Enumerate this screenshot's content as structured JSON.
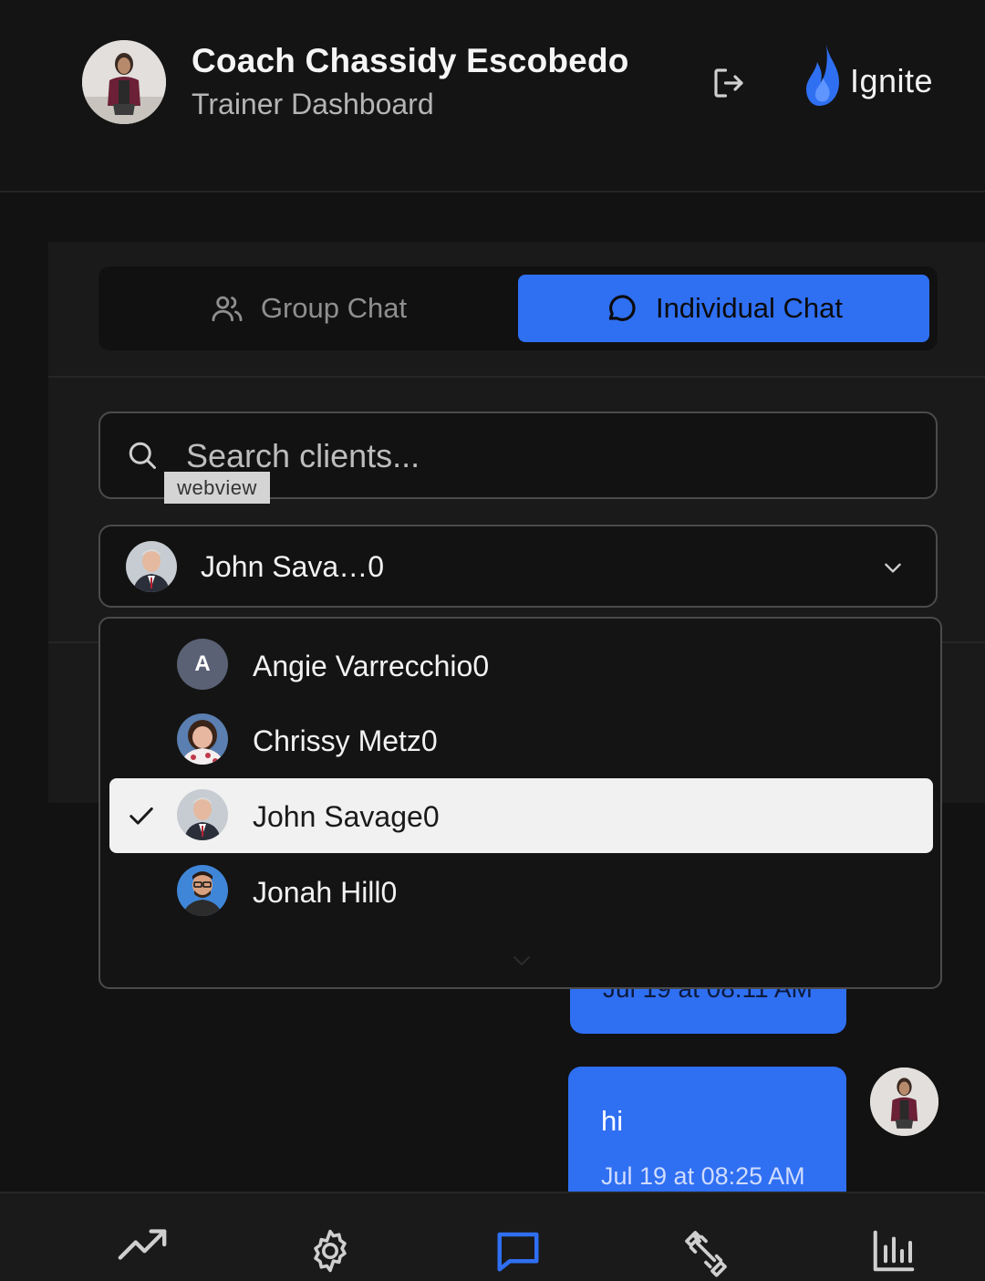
{
  "header": {
    "coach_name": "Coach Chassidy Escobedo",
    "subtitle": "Trainer Dashboard",
    "logo_text": "Ignite",
    "logout_icon": "logout-icon"
  },
  "tabs": [
    {
      "label": "Group Chat",
      "icon": "users-icon",
      "active": false
    },
    {
      "label": "Individual Chat",
      "icon": "chat-bubble-icon",
      "active": true
    }
  ],
  "search": {
    "placeholder": "Search clients...",
    "overlay_tag": "webview"
  },
  "client_select": {
    "selected_value": "John Sava…0"
  },
  "client_options": [
    {
      "label": "Angie Varrecchio0",
      "avatar_letter": "A",
      "selected": false
    },
    {
      "label": "Chrissy Metz0",
      "selected": false
    },
    {
      "label": "John Savage0",
      "selected": true
    },
    {
      "label": "Jonah Hill0",
      "selected": false
    }
  ],
  "messages": [
    {
      "text": "",
      "time": "Jul 19 at 08:11 AM"
    },
    {
      "text": "hi",
      "time": "Jul 19 at 08:25 AM"
    }
  ],
  "bottom_nav": [
    {
      "icon": "trending-up-icon",
      "active": false
    },
    {
      "icon": "gear-icon",
      "active": false
    },
    {
      "icon": "chat-icon",
      "active": true
    },
    {
      "icon": "dumbbell-icon",
      "active": false
    },
    {
      "icon": "bar-chart-icon",
      "active": false
    }
  ],
  "colors": {
    "accent": "#2f6ff2",
    "background": "#121212",
    "panel": "#1a1a1a"
  }
}
